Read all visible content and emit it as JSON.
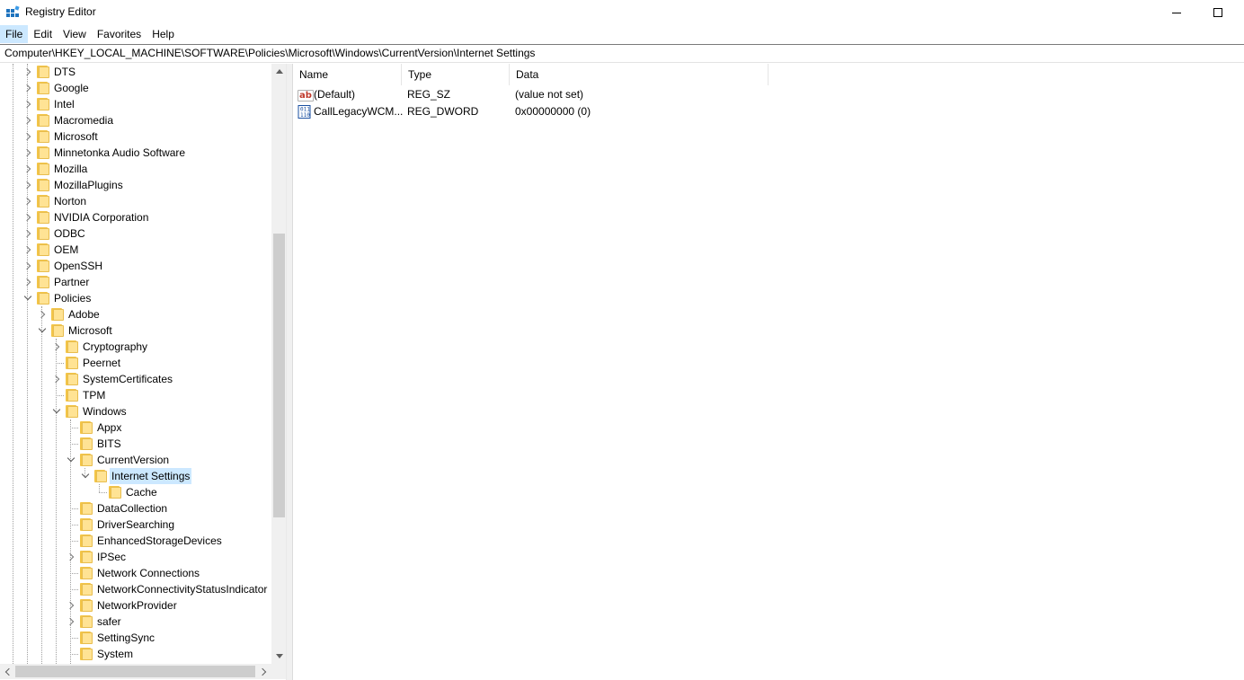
{
  "window": {
    "title": "Registry Editor"
  },
  "menu": {
    "items": [
      "File",
      "Edit",
      "View",
      "Favorites",
      "Help"
    ]
  },
  "address": {
    "path": "Computer\\HKEY_LOCAL_MACHINE\\SOFTWARE\\Policies\\Microsoft\\Windows\\CurrentVersion\\Internet Settings"
  },
  "tree": {
    "nodes": [
      {
        "label": "DTS",
        "level": 0,
        "state": "collapsed"
      },
      {
        "label": "Google",
        "level": 0,
        "state": "collapsed"
      },
      {
        "label": "Intel",
        "level": 0,
        "state": "collapsed"
      },
      {
        "label": "Macromedia",
        "level": 0,
        "state": "collapsed"
      },
      {
        "label": "Microsoft",
        "level": 0,
        "state": "collapsed"
      },
      {
        "label": "Minnetonka Audio Software",
        "level": 0,
        "state": "collapsed"
      },
      {
        "label": "Mozilla",
        "level": 0,
        "state": "collapsed"
      },
      {
        "label": "MozillaPlugins",
        "level": 0,
        "state": "collapsed"
      },
      {
        "label": "Norton",
        "level": 0,
        "state": "collapsed"
      },
      {
        "label": "NVIDIA Corporation",
        "level": 0,
        "state": "collapsed"
      },
      {
        "label": "ODBC",
        "level": 0,
        "state": "collapsed"
      },
      {
        "label": "OEM",
        "level": 0,
        "state": "collapsed"
      },
      {
        "label": "OpenSSH",
        "level": 0,
        "state": "collapsed"
      },
      {
        "label": "Partner",
        "level": 0,
        "state": "collapsed"
      },
      {
        "label": "Policies",
        "level": 0,
        "state": "expanded"
      },
      {
        "label": "Adobe",
        "level": 1,
        "state": "collapsed"
      },
      {
        "label": "Microsoft",
        "level": 1,
        "state": "expanded"
      },
      {
        "label": "Cryptography",
        "level": 2,
        "state": "collapsed"
      },
      {
        "label": "Peernet",
        "level": 2,
        "state": "leaf"
      },
      {
        "label": "SystemCertificates",
        "level": 2,
        "state": "collapsed"
      },
      {
        "label": "TPM",
        "level": 2,
        "state": "leaf"
      },
      {
        "label": "Windows",
        "level": 2,
        "state": "expanded"
      },
      {
        "label": "Appx",
        "level": 3,
        "state": "leaf"
      },
      {
        "label": "BITS",
        "level": 3,
        "state": "leaf"
      },
      {
        "label": "CurrentVersion",
        "level": 3,
        "state": "expanded"
      },
      {
        "label": "Internet Settings",
        "level": 4,
        "state": "expanded",
        "selected": true
      },
      {
        "label": "Cache",
        "level": 5,
        "state": "leaf"
      },
      {
        "label": "DataCollection",
        "level": 3,
        "state": "leaf"
      },
      {
        "label": "DriverSearching",
        "level": 3,
        "state": "leaf"
      },
      {
        "label": "EnhancedStorageDevices",
        "level": 3,
        "state": "leaf"
      },
      {
        "label": "IPSec",
        "level": 3,
        "state": "collapsed"
      },
      {
        "label": "Network Connections",
        "level": 3,
        "state": "leaf"
      },
      {
        "label": "NetworkConnectivityStatusIndicator",
        "level": 3,
        "state": "leaf"
      },
      {
        "label": "NetworkProvider",
        "level": 3,
        "state": "collapsed"
      },
      {
        "label": "safer",
        "level": 3,
        "state": "collapsed"
      },
      {
        "label": "SettingSync",
        "level": 3,
        "state": "leaf"
      },
      {
        "label": "System",
        "level": 3,
        "state": "leaf"
      }
    ]
  },
  "list": {
    "columns": [
      "Name",
      "Type",
      "Data"
    ],
    "rows": [
      {
        "name": "(Default)",
        "type": "REG_SZ",
        "data": "(value not set)",
        "icon": "string-value-icon"
      },
      {
        "name": "CallLegacyWCM...",
        "type": "REG_DWORD",
        "data": "0x00000000 (0)",
        "icon": "binary-value-icon"
      }
    ]
  },
  "colors": {
    "selection": "#cce8ff",
    "folder": "#ffe394",
    "scrollbar_thumb": "#cdcdcd"
  }
}
